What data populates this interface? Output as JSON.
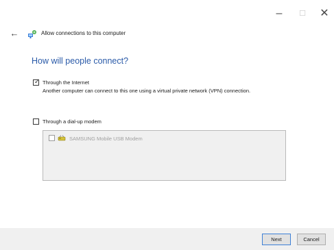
{
  "window": {
    "minimize_glyph": "–",
    "maximize_glyph": "☐",
    "close_glyph": "✕"
  },
  "nav": {
    "back_glyph": "←",
    "icon": "network-connections-icon",
    "title": "Allow connections to this computer"
  },
  "main": {
    "heading": "How will people connect?",
    "options": [
      {
        "label": "Through the Internet",
        "checked": true,
        "description": "Another computer can connect to this one using a virtual private network (VPN) connection."
      },
      {
        "label": "Through a dial-up modem",
        "checked": false
      }
    ],
    "modems": [
      {
        "label": "SAMSUNG Mobile USB Modem",
        "checked": false,
        "icon": "modem-icon",
        "disabled": true
      }
    ]
  },
  "footer": {
    "next_label": "Next",
    "cancel_label": "Cancel"
  },
  "colors": {
    "heading": "#2a5aa8",
    "footer_bg": "#f0f0f0",
    "list_bg": "#f0f0f0",
    "disabled_text": "#a0a0a0"
  }
}
